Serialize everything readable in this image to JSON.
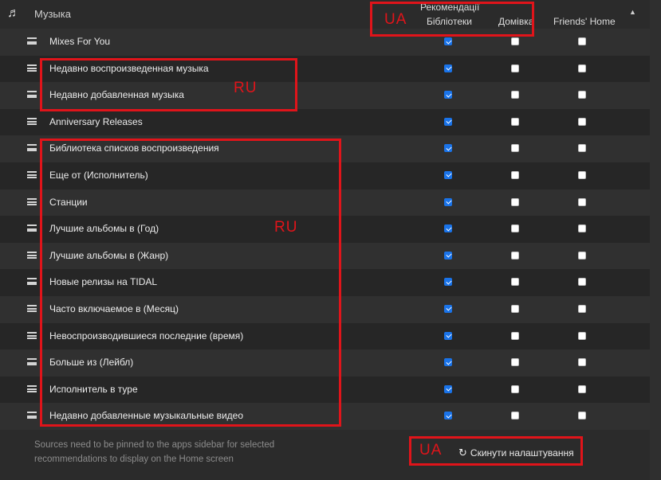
{
  "header": {
    "title": "Музыка",
    "group_label": "Рекомендації",
    "columns": [
      "Бібліотеки",
      "Домівка",
      "Friends' Home"
    ],
    "music_icon": "music-note-icon",
    "sort_icon": "sort-up-icon"
  },
  "rows": [
    {
      "label": "Mixes For You",
      "checks": [
        true,
        false,
        false
      ]
    },
    {
      "label": "Недавно воспроизведенная музыка",
      "checks": [
        true,
        false,
        false
      ]
    },
    {
      "label": "Недавно добавленная музыка",
      "checks": [
        true,
        false,
        false
      ]
    },
    {
      "label": "Anniversary Releases",
      "checks": [
        true,
        false,
        false
      ]
    },
    {
      "label": "Библиотека списков воспроизведения",
      "checks": [
        true,
        false,
        false
      ]
    },
    {
      "label": "Еще от (Исполнитель)",
      "checks": [
        true,
        false,
        false
      ]
    },
    {
      "label": "Станции",
      "checks": [
        true,
        false,
        false
      ]
    },
    {
      "label": "Лучшие альбомы в (Год)",
      "checks": [
        true,
        false,
        false
      ]
    },
    {
      "label": "Лучшие альбомы в (Жанр)",
      "checks": [
        true,
        false,
        false
      ]
    },
    {
      "label": "Новые релизы на TIDAL",
      "checks": [
        true,
        false,
        false
      ]
    },
    {
      "label": "Часто включаемое в (Месяц)",
      "checks": [
        true,
        false,
        false
      ]
    },
    {
      "label": "Невоспроизводившиеся последние (время)",
      "checks": [
        true,
        false,
        false
      ]
    },
    {
      "label": "Больше из (Лейбл)",
      "checks": [
        true,
        false,
        false
      ]
    },
    {
      "label": "Исполнитель в туре",
      "checks": [
        true,
        false,
        false
      ]
    },
    {
      "label": "Недавно добавленные музыкальные видео",
      "checks": [
        true,
        false,
        false
      ]
    }
  ],
  "footer": {
    "note": "Sources need to be pinned to the apps sidebar for selected recommendations to display on the Home screen",
    "reset_label": "Скинути налаштування",
    "reset_icon": "refresh-icon"
  },
  "annotations": {
    "header_tag": "UA",
    "recent_tag": "RU",
    "list_tag": "RU",
    "reset_tag": "UA"
  },
  "colors": {
    "annotation": "#e0141a",
    "checkbox_checked": "#1a73e8"
  }
}
